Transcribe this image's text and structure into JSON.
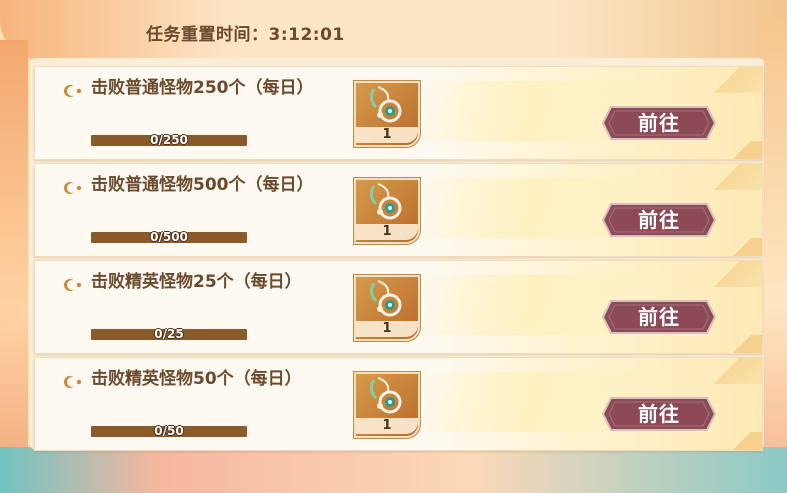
{
  "header": {
    "timer_label": "任务重置时间：3:12:01"
  },
  "colors": {
    "accent": "#8b4a55",
    "progress_track": "#8b5a2b",
    "title_text": "#6b4a2e"
  },
  "quests": [
    {
      "title": "击败普通怪物250个（每日）",
      "progress_text": "0/250",
      "progress": 0,
      "reward_icon": "necklace-item-icon",
      "reward_qty": "1",
      "button_label": "前往"
    },
    {
      "title": "击败普通怪物500个（每日）",
      "progress_text": "0/500",
      "progress": 0,
      "reward_icon": "necklace-item-icon",
      "reward_qty": "1",
      "button_label": "前往"
    },
    {
      "title": "击败精英怪物25个（每日）",
      "progress_text": "0/25",
      "progress": 0,
      "reward_icon": "necklace-item-icon",
      "reward_qty": "1",
      "button_label": "前往"
    },
    {
      "title": "击败精英怪物50个（每日）",
      "progress_text": "0/50",
      "progress": 0,
      "reward_icon": "necklace-item-icon",
      "reward_qty": "1",
      "button_label": "前往"
    }
  ]
}
